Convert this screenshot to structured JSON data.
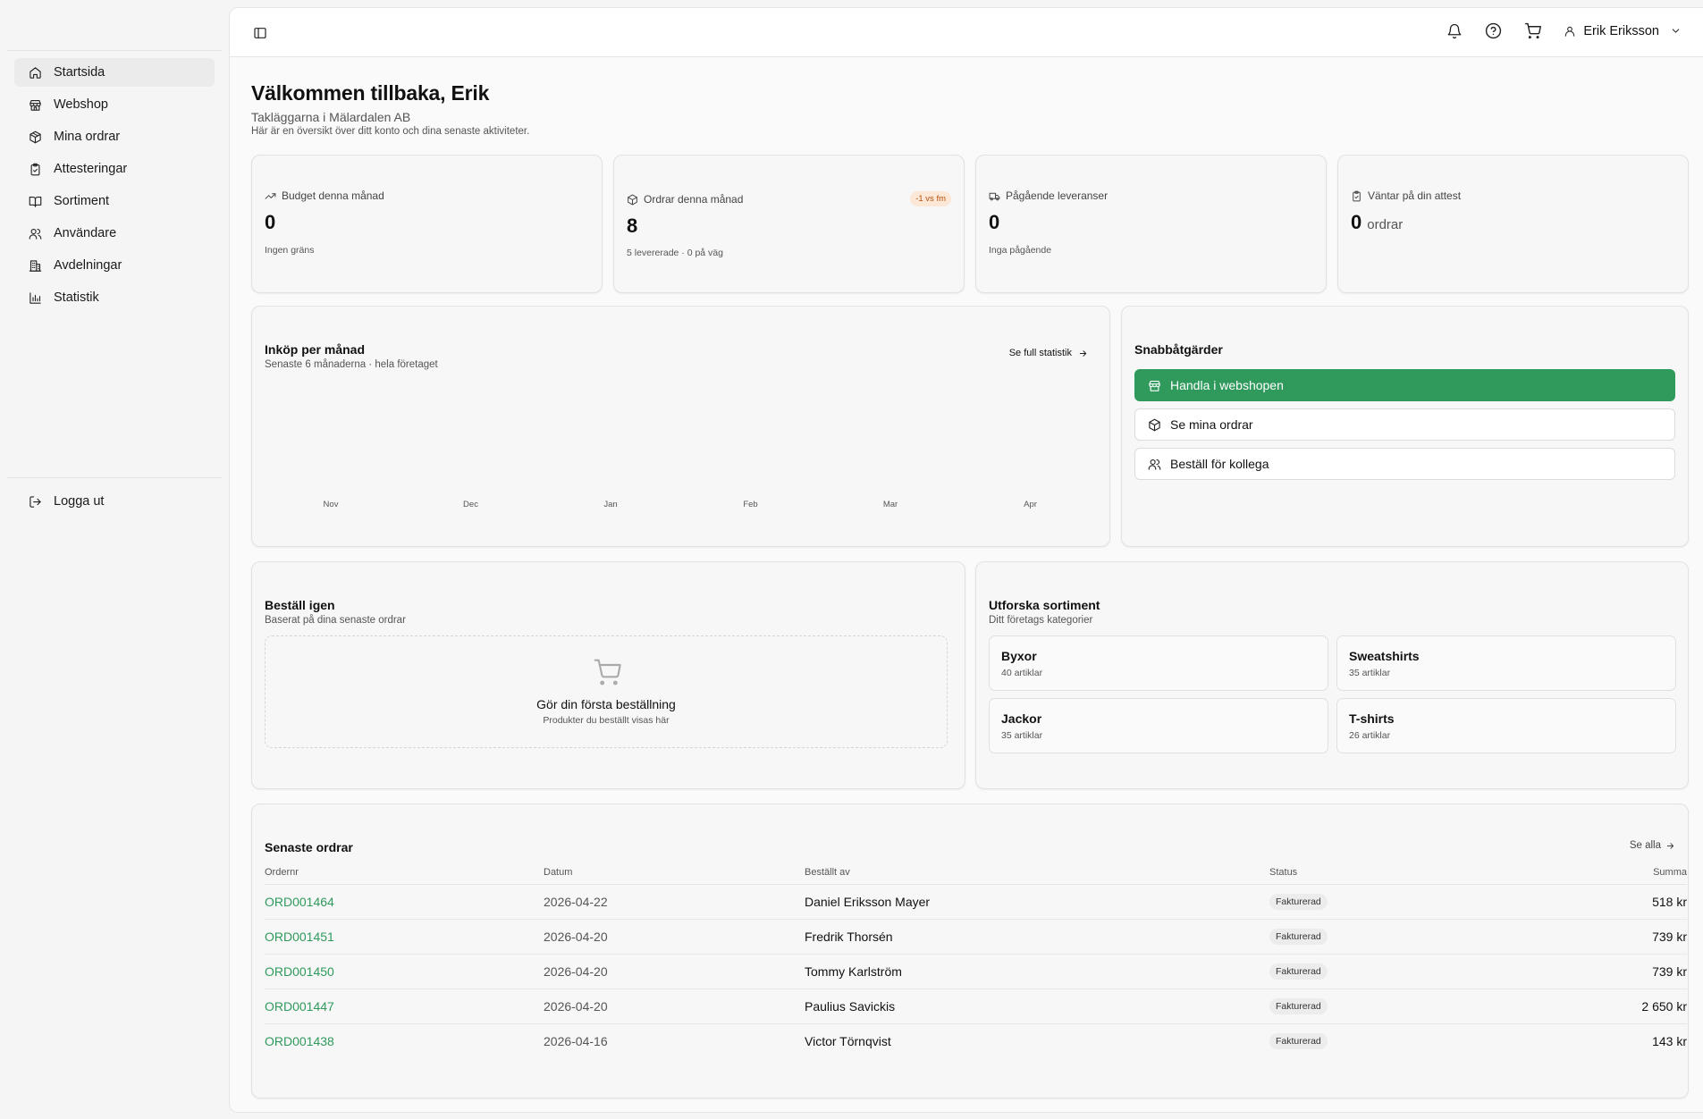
{
  "sidebar": {
    "items": [
      {
        "label": "Startsida",
        "icon": "home-icon",
        "active": true
      },
      {
        "label": "Webshop",
        "icon": "store-icon"
      },
      {
        "label": "Mina ordrar",
        "icon": "package-icon"
      },
      {
        "label": "Attesteringar",
        "icon": "clipboard-check-icon"
      },
      {
        "label": "Sortiment",
        "icon": "book-open-icon"
      },
      {
        "label": "Användare",
        "icon": "users-icon"
      },
      {
        "label": "Avdelningar",
        "icon": "building-icon"
      },
      {
        "label": "Statistik",
        "icon": "bar-chart-icon"
      }
    ],
    "logout": "Logga ut"
  },
  "header": {
    "user_name": "Erik Eriksson"
  },
  "welcome": {
    "title": "Välkommen tillbaka, Erik",
    "company": "Takläggarna i Mälardalen AB",
    "description": "Här är en översikt över ditt konto och dina senaste aktiviteter."
  },
  "stats": [
    {
      "label": "Budget denna månad",
      "value": "0",
      "sub": "Ingen gräns",
      "icon": "trending-up-icon"
    },
    {
      "label": "Ordrar denna månad",
      "value": "8",
      "sub": "5 levererade · 0 på väg",
      "badge": "-1 vs fm",
      "icon": "package-icon"
    },
    {
      "label": "Pågående leveranser",
      "value": "0",
      "sub": "Inga pågående",
      "icon": "truck-icon"
    },
    {
      "label": "Väntar på din attest",
      "value": "0",
      "unit": "ordrar",
      "icon": "clipboard-check-icon"
    }
  ],
  "purchases": {
    "title": "Inköp per månad",
    "subtitle": "Senaste 6 månaderna · hela företaget",
    "link": "Se full statistik",
    "months": [
      "Nov",
      "Dec",
      "Jan",
      "Feb",
      "Mar",
      "Apr"
    ]
  },
  "chart_data": {
    "type": "bar",
    "title": "Inköp per månad",
    "categories": [
      "Nov",
      "Dec",
      "Jan",
      "Feb",
      "Mar",
      "Apr"
    ],
    "values": [
      0,
      0,
      0,
      0,
      0,
      0
    ]
  },
  "quick_actions": {
    "title": "Snabbåtgärder",
    "buttons": [
      {
        "label": "Handla i webshopen",
        "icon": "store-icon",
        "primary": true
      },
      {
        "label": "Se mina ordrar",
        "icon": "package-icon"
      },
      {
        "label": "Beställ för kollega",
        "icon": "users-icon"
      }
    ]
  },
  "reorder": {
    "title": "Beställ igen",
    "subtitle": "Baserat på dina senaste ordrar",
    "empty_title": "Gör din första beställning",
    "empty_sub": "Produkter du beställt visas här"
  },
  "explore": {
    "title": "Utforska sortiment",
    "subtitle": "Ditt företags kategorier",
    "categories": [
      {
        "name": "Byxor",
        "count": "40 artiklar"
      },
      {
        "name": "Sweatshirts",
        "count": "35 artiklar"
      },
      {
        "name": "Jackor",
        "count": "35 artiklar"
      },
      {
        "name": "T-shirts",
        "count": "26 artiklar"
      }
    ]
  },
  "recent_orders": {
    "title": "Senaste ordrar",
    "see_all": "Se alla",
    "columns": [
      "Ordernr",
      "Datum",
      "Beställt av",
      "Status",
      "Summa"
    ],
    "rows": [
      {
        "ordnr": "ORD001464",
        "date": "2026-04-22",
        "by": "Daniel Eriksson Mayer",
        "status": "Fakturerad",
        "sum": "518 kr"
      },
      {
        "ordnr": "ORD001451",
        "date": "2026-04-20",
        "by": "Fredrik Thorsén",
        "status": "Fakturerad",
        "sum": "739 kr"
      },
      {
        "ordnr": "ORD001450",
        "date": "2026-04-20",
        "by": "Tommy Karlström",
        "status": "Fakturerad",
        "sum": "739 kr"
      },
      {
        "ordnr": "ORD001447",
        "date": "2026-04-20",
        "by": "Paulius Savickis",
        "status": "Fakturerad",
        "sum": "2 650 kr"
      },
      {
        "ordnr": "ORD001438",
        "date": "2026-04-16",
        "by": "Victor Törnqvist",
        "status": "Fakturerad",
        "sum": "143 kr"
      }
    ]
  },
  "colors": {
    "accent": "#2f9a5c",
    "badge_bg": "#fde7d6",
    "badge_text": "#b4510d"
  }
}
